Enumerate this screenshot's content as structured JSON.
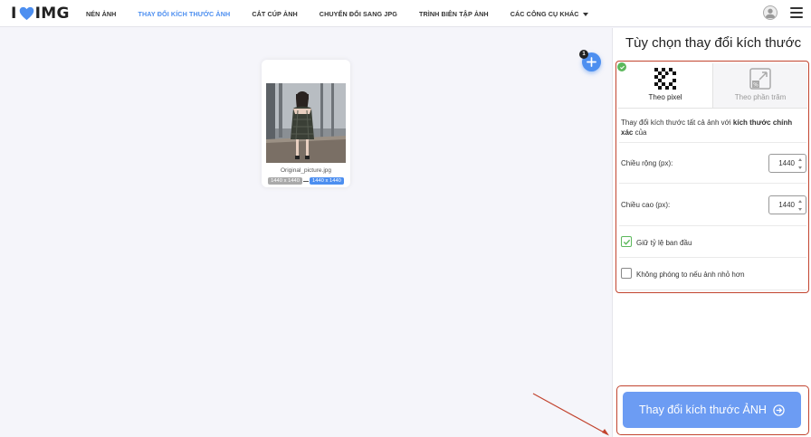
{
  "header": {
    "logo_left": "I",
    "logo_right": "IMG",
    "nav": [
      {
        "label": "NÉN ẢNH",
        "active": false
      },
      {
        "label": "THAY ĐỔI KÍCH THƯỚC ẢNH",
        "active": true
      },
      {
        "label": "CẮT CÚP ẢNH",
        "active": false
      },
      {
        "label": "CHUYỂN ĐỔI SANG JPG",
        "active": false
      },
      {
        "label": "TRÌNH BIÊN TẬP ẢNH",
        "active": false
      },
      {
        "label": "CÁC CÔNG CỤ KHÁC",
        "active": false
      }
    ]
  },
  "workspace": {
    "add_badge_count": "1",
    "file": {
      "name": "Original_picture.jpg",
      "original_size": "1440 x 1440",
      "new_size": "1440 x 1440"
    }
  },
  "sidebar": {
    "title": "Tùy chọn thay đổi kích thước",
    "tabs": {
      "pixel": "Theo pixel",
      "percent": "Theo phần trăm"
    },
    "description_prefix": "Thay đổi kích thước tất cả ảnh với ",
    "description_bold": "kích thước chính xác",
    "description_suffix": " của",
    "width_label": "Chiều rộng (px):",
    "width_value": "1440",
    "height_label": "Chiều cao (px):",
    "height_value": "1440",
    "keep_ratio_label": "Giữ tỷ lệ ban đầu",
    "keep_ratio_checked": true,
    "no_enlarge_label": "Không phóng to nếu ảnh nhỏ hơn",
    "no_enlarge_checked": false,
    "submit_label": "Thay đổi kích thước ẢNH"
  },
  "colors": {
    "accent": "#4d8ff0",
    "button": "#6c9cf3",
    "highlight": "#c2442f",
    "check": "#5cb85c",
    "logo_heart": "#4d8ff0"
  },
  "icons": [
    "heart-icon",
    "caret-down-icon",
    "user-icon",
    "menu-icon",
    "plus-icon",
    "check-icon",
    "pixel-resize-icon",
    "percent-resize-icon",
    "arrow-right-circle-icon"
  ]
}
